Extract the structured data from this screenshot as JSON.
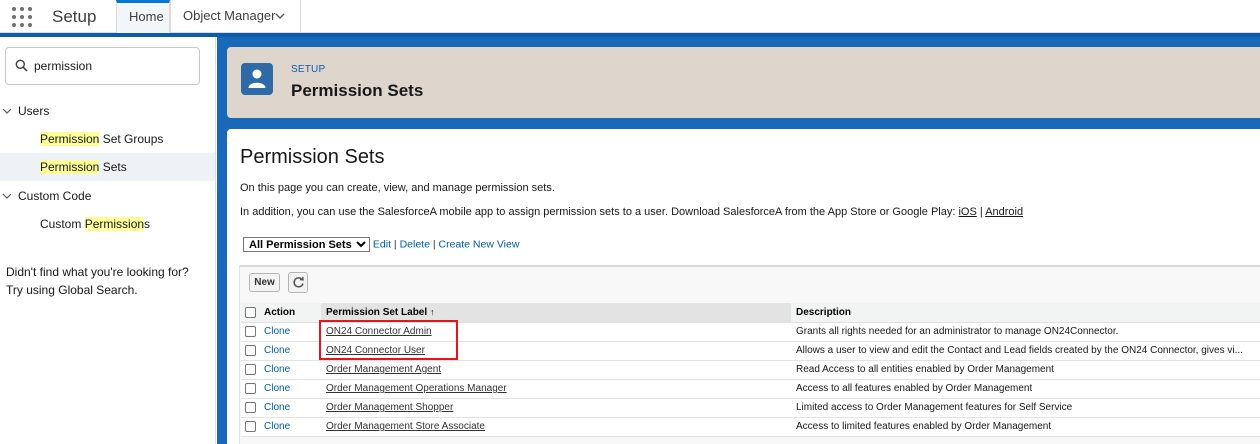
{
  "app": {
    "title": "Setup",
    "tabs": [
      {
        "label": "Home"
      },
      {
        "label": "Object Manager"
      }
    ]
  },
  "sidebar": {
    "search_value": "permission",
    "groups": [
      {
        "label": "Users",
        "items": [
          {
            "pre": "",
            "match": "Permission",
            "post": " Set Groups"
          },
          {
            "pre": "",
            "match": "Permission",
            "post": " Sets",
            "selected": true
          }
        ]
      },
      {
        "label": "Custom Code",
        "items": [
          {
            "pre": "Custom ",
            "match": "Permission",
            "post": "s"
          }
        ]
      }
    ],
    "help_line1": "Didn't find what you're looking for?",
    "help_line2": "Try using Global Search."
  },
  "header": {
    "eyebrow": "SETUP",
    "title": "Permission Sets"
  },
  "content": {
    "heading": "Permission Sets",
    "intro1": "On this page you can create, view, and manage permission sets.",
    "intro2_prefix": "In addition, you can use the SalesforceA mobile app to assign permission sets to a user. Download SalesforceA from the App Store or Google Play: ",
    "link_ios": "iOS",
    "link_sep": "|",
    "link_android": "Android",
    "view": {
      "selected": "All Permission Sets",
      "edit": "Edit",
      "delete": "Delete",
      "create": "Create New View"
    },
    "buttons": {
      "new": "New"
    },
    "columns": {
      "action": "Action",
      "label": "Permission Set Label",
      "sort_indicator": "↑",
      "description": "Description"
    },
    "rows": [
      {
        "action": "Clone",
        "label": "ON24 Connector Admin",
        "description": "Grants all rights needed for an administrator to manage ON24Connector."
      },
      {
        "action": "Clone",
        "label": "ON24 Connector User",
        "description": "Allows a user to view and edit the Contact and Lead fields created by the ON24 Connector, gives vi..."
      },
      {
        "action": "Clone",
        "label": "Order Management Agent",
        "description": "Read Access to all entities enabled by Order Management"
      },
      {
        "action": "Clone",
        "label": "Order Management Operations Manager",
        "description": "Access to all features enabled by Order Management"
      },
      {
        "action": "Clone",
        "label": "Order Management Shopper",
        "description": "Limited access to Order Management features for Self Service"
      },
      {
        "action": "Clone",
        "label": "Order Management Store Associate",
        "description": "Access to limited features enabled by Order Management"
      }
    ]
  }
}
